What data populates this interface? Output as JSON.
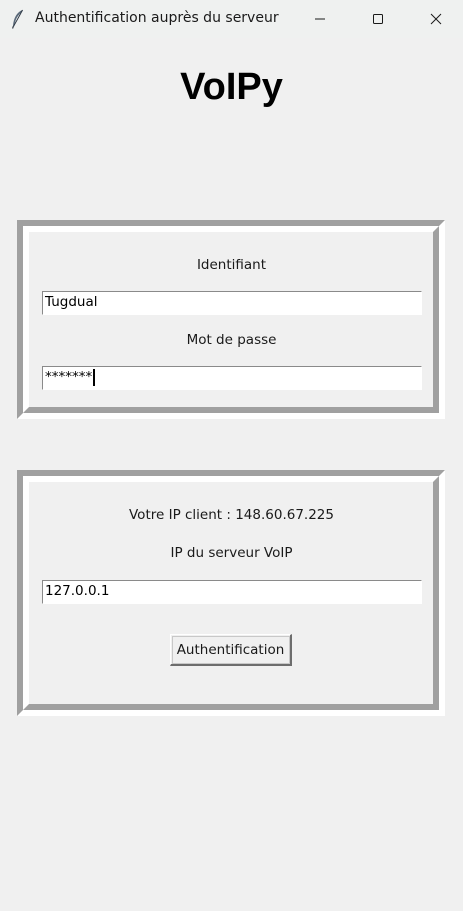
{
  "window": {
    "title": "Authentification auprès du serveur",
    "app_icon": "feather-icon",
    "controls": {
      "minimize": "minimize-icon",
      "maximize": "maximize-icon",
      "close": "close-icon"
    }
  },
  "header": {
    "title": "VoIPy"
  },
  "login": {
    "username_label": "Identifiant",
    "username_value": "Tugdual",
    "password_label": "Mot de passe",
    "password_value": "*******"
  },
  "server": {
    "client_ip_text": "Votre IP client : 148.60.67.225",
    "server_ip_label": "IP du serveur VoIP",
    "server_ip_value": "127.0.0.1",
    "auth_button_label": "Authentification"
  },
  "colors": {
    "background": "#f0f0f0",
    "titlebar": "#eff1f0",
    "frame_shadow": "#a0a0a0",
    "frame_highlight": "#ffffff"
  }
}
